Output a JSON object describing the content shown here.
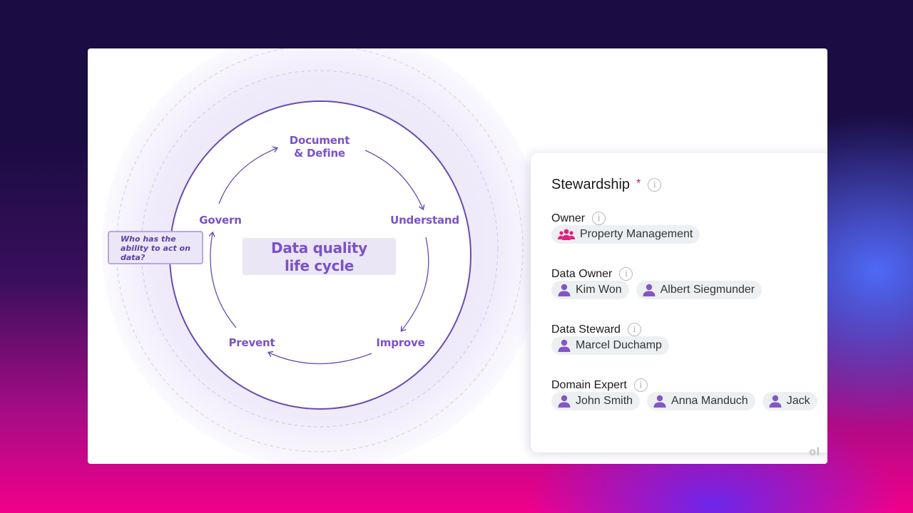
{
  "diagram": {
    "center_title_line1": "Data quality",
    "center_title_line2": "life cycle",
    "stages": [
      {
        "line1": "Document",
        "line2": "& Define"
      },
      {
        "line1": "Understand"
      },
      {
        "line1": "Improve"
      },
      {
        "line1": "Prevent"
      },
      {
        "line1": "Govern"
      }
    ],
    "callout": {
      "line1": "Who has the",
      "line2": "ability to act on",
      "line3": "data?"
    },
    "accent_color": "#7a52c8"
  },
  "stewardship": {
    "title": "Stewardship",
    "required_marker": "*",
    "info_icon": "i",
    "fields": [
      {
        "label": "Owner",
        "chips": [
          {
            "icon": "group-icon",
            "name": "Property Management"
          }
        ]
      },
      {
        "label": "Data Owner",
        "chips": [
          {
            "icon": "person-icon",
            "name": "Kim Won"
          },
          {
            "icon": "person-icon",
            "name": "Albert Siegmunder"
          }
        ]
      },
      {
        "label": "Data Steward",
        "chips": [
          {
            "icon": "person-icon",
            "name": "Marcel Duchamp"
          }
        ]
      },
      {
        "label": "Domain Expert",
        "chips": [
          {
            "icon": "person-icon",
            "name": "John Smith"
          },
          {
            "icon": "person-icon",
            "name": "Anna Manduch"
          },
          {
            "icon": "person-icon",
            "name": "Jack"
          }
        ]
      }
    ],
    "group_icon_color": "#e0207a",
    "person_icon_color": "#8256c8",
    "required_color": "#c2185b"
  },
  "watermark": "ol"
}
